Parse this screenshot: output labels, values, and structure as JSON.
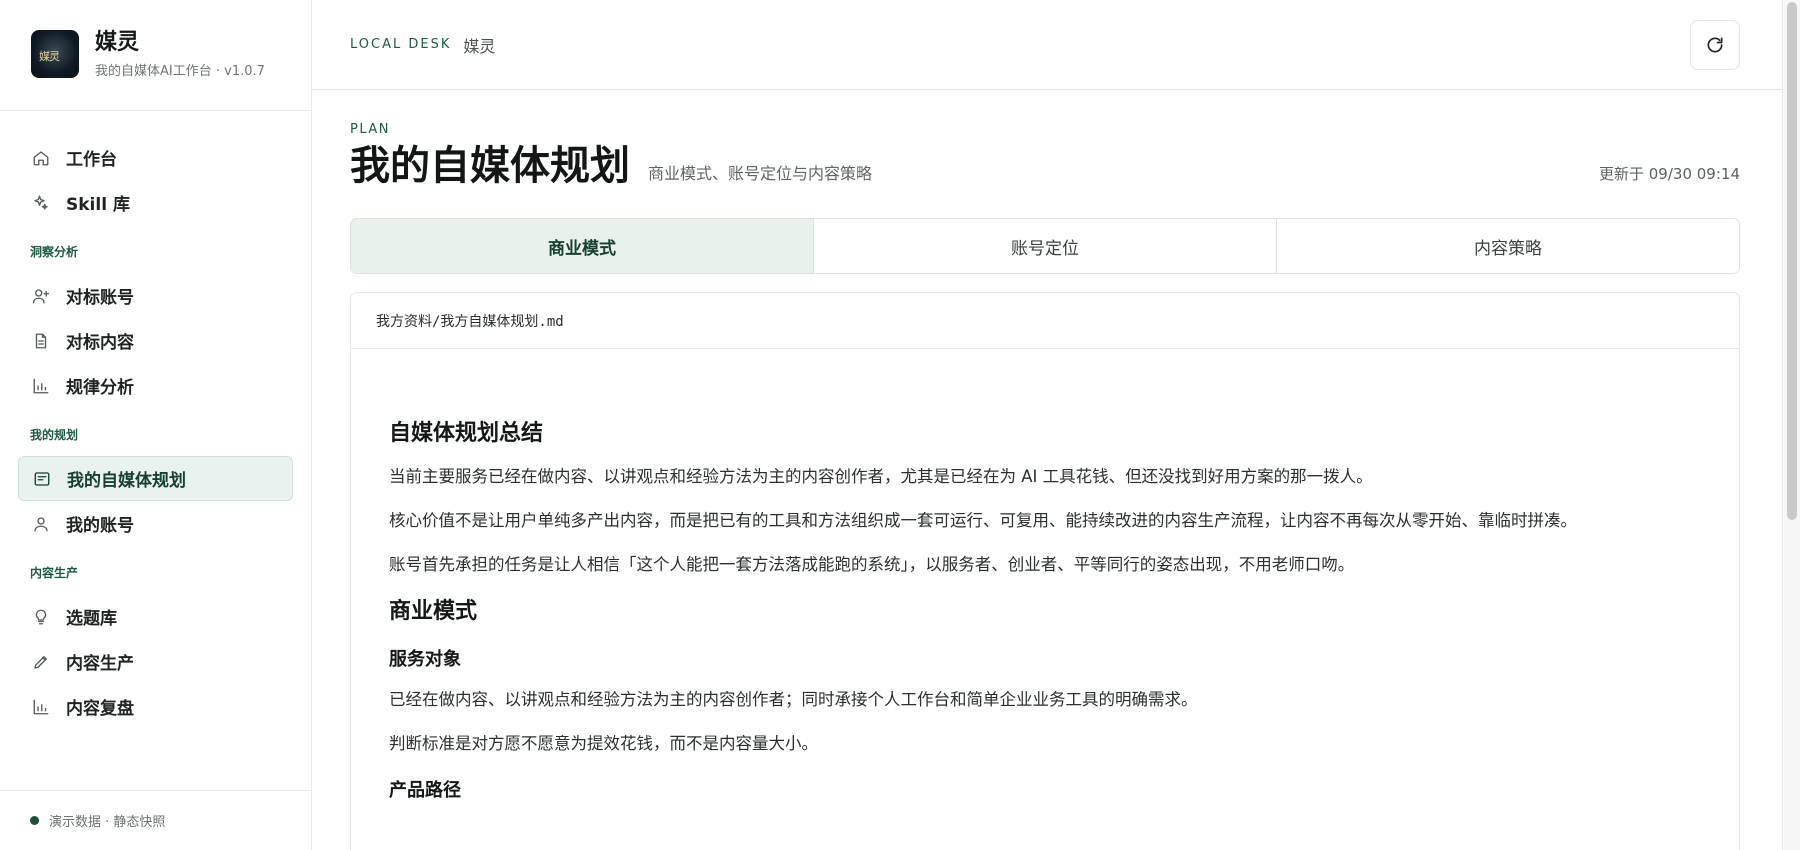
{
  "sidebar": {
    "logo_text": "媒灵",
    "brand_name": "媒灵",
    "brand_sub": "我的自媒体AI工作台 · v1.0.7",
    "top_items": [
      {
        "label": "工作台",
        "icon": "home-icon"
      },
      {
        "label": "Skill 库",
        "icon": "sparkle-icon"
      }
    ],
    "sections": [
      {
        "label": "洞察分析",
        "items": [
          {
            "label": "对标账号",
            "icon": "user-plus-icon"
          },
          {
            "label": "对标内容",
            "icon": "document-icon"
          },
          {
            "label": "规律分析",
            "icon": "bar-chart-icon"
          }
        ]
      },
      {
        "label": "我的规划",
        "items": [
          {
            "label": "我的自媒体规划",
            "icon": "plan-icon",
            "active": true
          },
          {
            "label": "我的账号",
            "icon": "user-icon"
          }
        ]
      },
      {
        "label": "内容生产",
        "items": [
          {
            "label": "选题库",
            "icon": "bulb-icon"
          },
          {
            "label": "内容生产",
            "icon": "pencil-icon"
          },
          {
            "label": "内容复盘",
            "icon": "bar-chart-icon"
          }
        ]
      }
    ],
    "footer": "演示数据 · 静态快照"
  },
  "topbar": {
    "eyebrow": "LOCAL DESK",
    "app": "媒灵",
    "refresh_icon": "refresh-icon"
  },
  "page": {
    "plan_label": "PLAN",
    "title": "我的自媒体规划",
    "subtitle": "商业模式、账号定位与内容策略",
    "updated": "更新于 09/30 09:14",
    "tabs": [
      "商业模式",
      "账号定位",
      "内容策略"
    ],
    "active_tab": 0
  },
  "doc": {
    "path": "我方资料/我方自媒体规划.md",
    "h_summary": "自媒体规划总结",
    "p1": "当前主要服务已经在做内容、以讲观点和经验方法为主的内容创作者，尤其是已经在为 AI 工具花钱、但还没找到好用方案的那一拨人。",
    "p2": "核心价值不是让用户单纯多产出内容，而是把已有的工具和方法组织成一套可运行、可复用、能持续改进的内容生产流程，让内容不再每次从零开始、靠临时拼凑。",
    "p3": "账号首先承担的任务是让人相信「这个人能把一套方法落成能跑的系统」，以服务者、创业者、平等同行的姿态出现，不用老师口吻。",
    "h_business": "商业模式",
    "h_audience": "服务对象",
    "p4": "已经在做内容、以讲观点和经验方法为主的内容创作者；同时承接个人工作台和简单企业业务工具的明确需求。",
    "p5": "判断标准是对方愿不愿意为提效花钱，而不是内容量大小。",
    "h_product": "产品路径"
  },
  "colors": {
    "accent": "#1e5b40",
    "active_bg": "#e9f2ee"
  }
}
